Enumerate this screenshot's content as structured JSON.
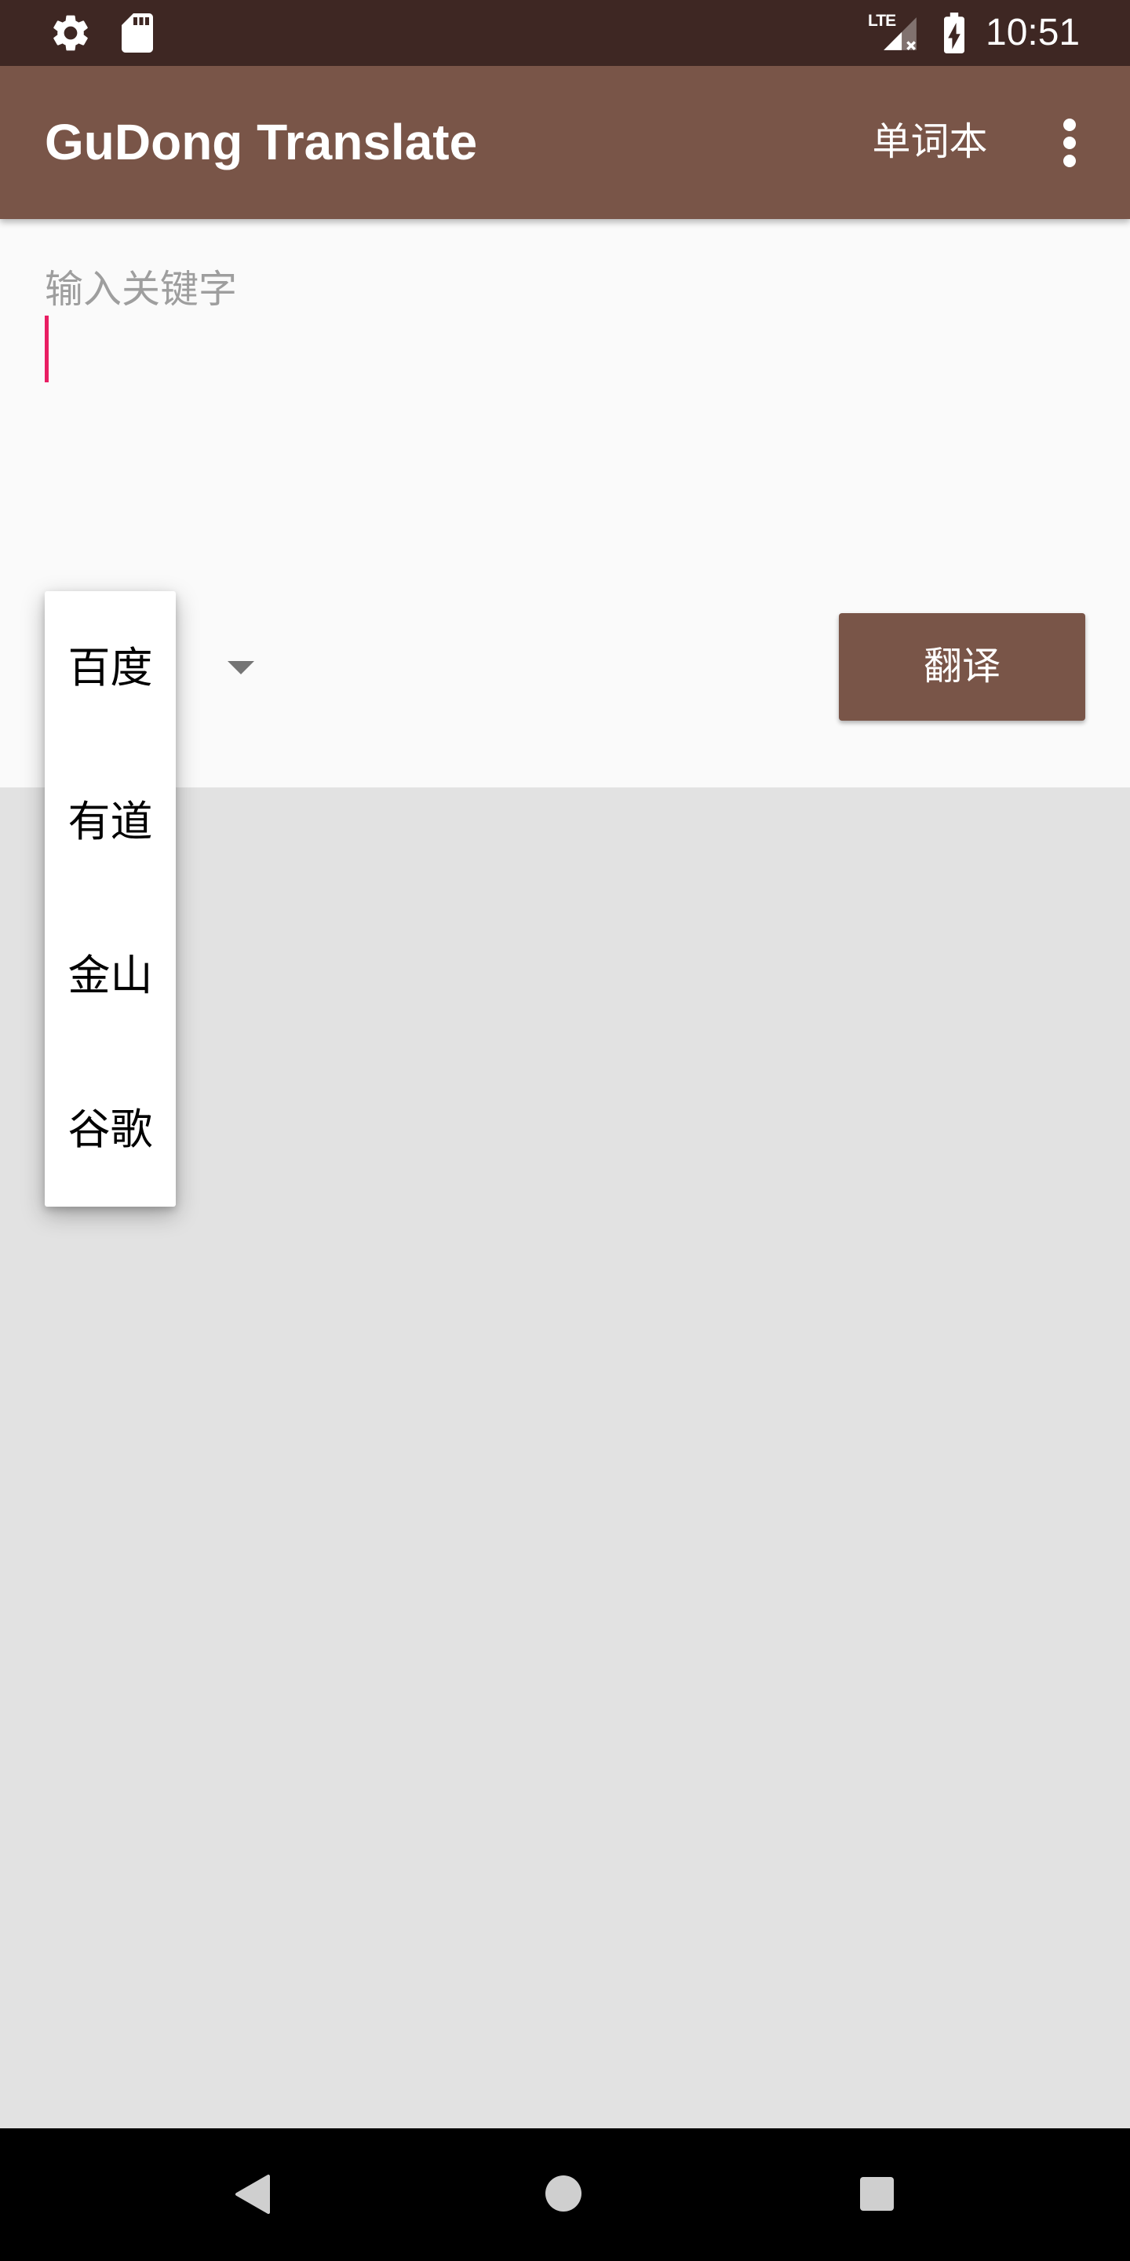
{
  "status_bar": {
    "time": "10:51",
    "network_type": "LTE",
    "icons": {
      "settings": "settings-icon",
      "sd_card": "sd-card-icon",
      "signal": "signal-no-data-icon",
      "battery": "battery-charging-icon"
    }
  },
  "app_bar": {
    "title": "GuDong Translate",
    "vocabulary_action": "单词本",
    "overflow_icon": "more-vert-icon"
  },
  "input": {
    "hint": "输入关键字",
    "value": ""
  },
  "engine_spinner": {
    "dropdown_icon": "arrow-drop-down-icon",
    "options": [
      "百度",
      "有道",
      "金山",
      "谷歌"
    ]
  },
  "translate_button": {
    "label": "翻译"
  },
  "nav_bar": {
    "icons": {
      "back": "back-icon",
      "home": "home-icon",
      "recents": "recents-icon"
    }
  },
  "colors": {
    "primary": "#795548",
    "primary_dark": "#3E2723",
    "accent": "#E91E63",
    "content_background": "#FAFAFA",
    "result_background": "#E2E2E2",
    "hint_text": "#9E9E9E",
    "button_text": "#FFFFFF"
  }
}
